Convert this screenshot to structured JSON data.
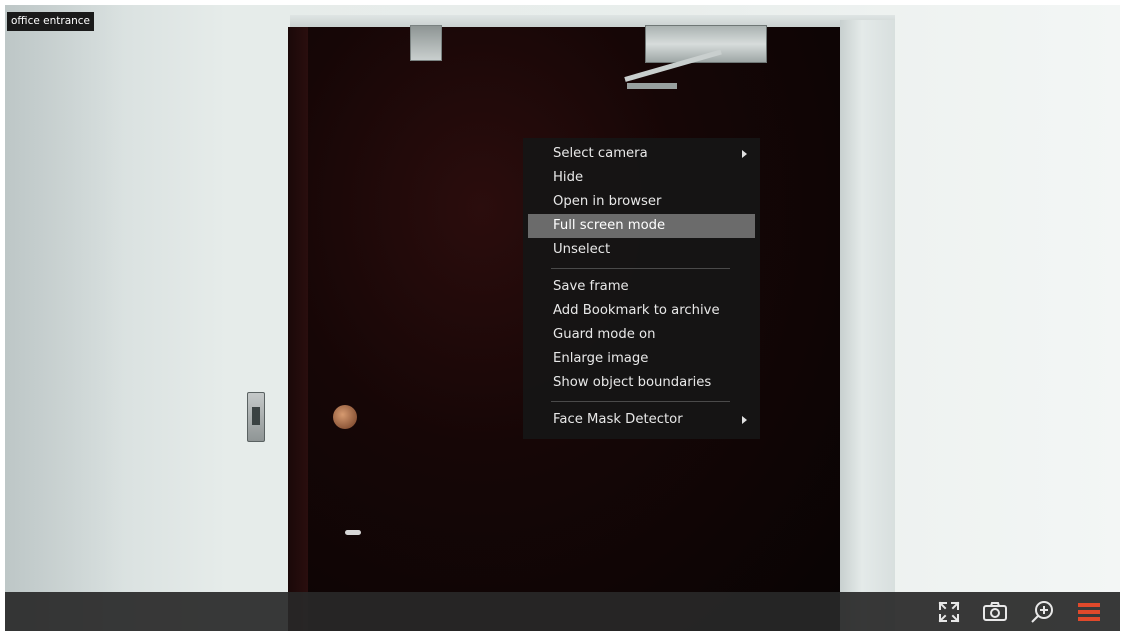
{
  "camera": {
    "label": "office entrance"
  },
  "context_menu": {
    "items": [
      {
        "label": "Select camera",
        "has_submenu": true,
        "highlighted": false
      },
      {
        "label": "Hide",
        "has_submenu": false,
        "highlighted": false
      },
      {
        "label": "Open in browser",
        "has_submenu": false,
        "highlighted": false
      },
      {
        "label": "Full screen mode",
        "has_submenu": false,
        "highlighted": true
      },
      {
        "label": "Unselect",
        "has_submenu": false,
        "highlighted": false
      },
      {
        "label": "Save frame",
        "has_submenu": false,
        "highlighted": false
      },
      {
        "label": "Add Bookmark to archive",
        "has_submenu": false,
        "highlighted": false
      },
      {
        "label": "Guard mode on",
        "has_submenu": false,
        "highlighted": false
      },
      {
        "label": "Enlarge image",
        "has_submenu": false,
        "highlighted": false
      },
      {
        "label": "Show object boundaries",
        "has_submenu": false,
        "highlighted": false
      },
      {
        "label": "Face Mask Detector",
        "has_submenu": true,
        "highlighted": false
      }
    ]
  },
  "toolbar": {
    "buttons": [
      {
        "icon": "fullscreen-icon"
      },
      {
        "icon": "camera-snapshot-icon"
      },
      {
        "icon": "zoom-in-icon"
      },
      {
        "icon": "menu-icon",
        "color": "#e0492b"
      }
    ]
  },
  "colors": {
    "menu_bg": "#161616",
    "menu_highlight": "#6b6b6b",
    "accent": "#e0492b"
  }
}
